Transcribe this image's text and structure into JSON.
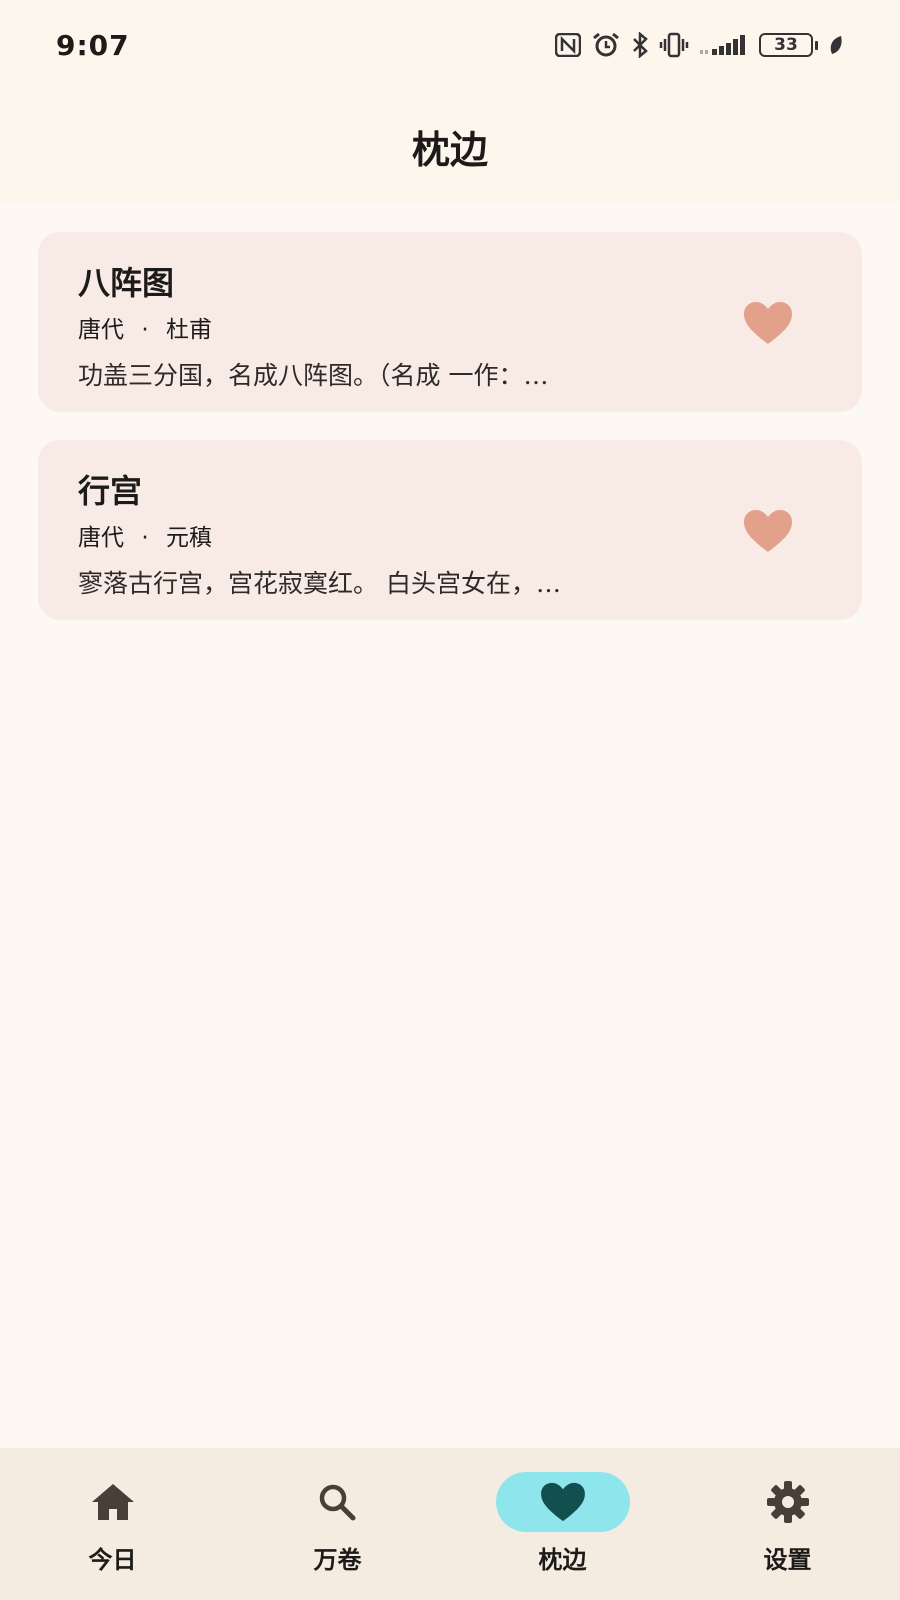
{
  "status_bar": {
    "time": "9:07",
    "battery": "33",
    "icons": [
      "nfc-icon",
      "alarm-icon",
      "bluetooth-icon",
      "vibrate-icon",
      "signal-icon",
      "battery-icon",
      "leaf-icon"
    ]
  },
  "header": {
    "title": "枕边"
  },
  "favorites": [
    {
      "title": "八阵图",
      "dynasty": "唐代",
      "separator": "·",
      "author": "杜甫",
      "excerpt": "功盖三分国，名成八阵图。（名成 一作：…",
      "icon": "heart-icon"
    },
    {
      "title": "行宫",
      "dynasty": "唐代",
      "separator": "·",
      "author": "元稹",
      "excerpt": "寥落古行宫，宫花寂寞红。 白头宫女在，…",
      "icon": "heart-icon"
    }
  ],
  "colors": {
    "accent_heart": "#e3a08a",
    "nav_active_bg": "#8ee5ec",
    "nav_active_icon": "#124f4f",
    "card_bg": "#f8ebe6"
  },
  "bottom_nav": [
    {
      "label": "今日",
      "icon": "home-icon",
      "active": false
    },
    {
      "label": "万卷",
      "icon": "search-icon",
      "active": false
    },
    {
      "label": "枕边",
      "icon": "heart-icon",
      "active": true
    },
    {
      "label": "设置",
      "icon": "gear-icon",
      "active": false
    }
  ]
}
